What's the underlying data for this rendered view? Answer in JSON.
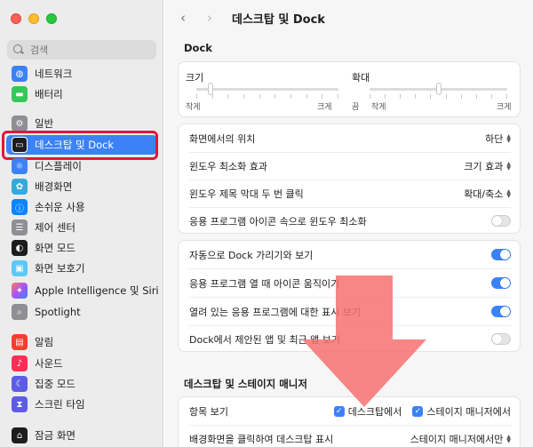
{
  "sidebar": {
    "search_placeholder": "검색",
    "items": [
      {
        "label": "네트워크",
        "icon": "network-icon",
        "color": "#3b82f6"
      },
      {
        "label": "배터리",
        "icon": "battery-icon",
        "color": "#34c759"
      },
      {
        "label": "일반",
        "icon": "gear-icon",
        "color": "#8e8e93"
      },
      {
        "label": "데스크탑 및 Dock",
        "icon": "dock-icon",
        "color": "#1d1d1f"
      },
      {
        "label": "디스플레이",
        "icon": "display-icon",
        "color": "#3b82f6"
      },
      {
        "label": "배경화면",
        "icon": "wallpaper-icon",
        "color": "#34aadc"
      },
      {
        "label": "손쉬운 사용",
        "icon": "accessibility-icon",
        "color": "#0a84ff"
      },
      {
        "label": "제어 센터",
        "icon": "control-center-icon",
        "color": "#8e8e93"
      },
      {
        "label": "화면 모드",
        "icon": "appearance-icon",
        "color": "#1d1d1f"
      },
      {
        "label": "화면 보호기",
        "icon": "screensaver-icon",
        "color": "#5ac8fa"
      },
      {
        "label": "Apple Intelligence 및 Siri",
        "icon": "siri-icon",
        "color": "#ff7a59"
      },
      {
        "label": "Spotlight",
        "icon": "spotlight-icon",
        "color": "#8e8e93"
      },
      {
        "label": "알림",
        "icon": "notifications-icon",
        "color": "#ff3b30"
      },
      {
        "label": "사운드",
        "icon": "sound-icon",
        "color": "#ff2d55"
      },
      {
        "label": "집중 모드",
        "icon": "focus-icon",
        "color": "#5e5ce6"
      },
      {
        "label": "스크린 타임",
        "icon": "screen-time-icon",
        "color": "#5e5ce6"
      },
      {
        "label": "잠금 화면",
        "icon": "lock-screen-icon",
        "color": "#1d1d1f"
      }
    ]
  },
  "toolbar": {
    "back": "‹",
    "forward": "›",
    "title": "데스크탑 및 Dock"
  },
  "dock": {
    "section_title": "Dock",
    "size_label": "크기",
    "size_min": "작게",
    "size_max": "크게",
    "size_value": 0.1,
    "magnify_label": "확대",
    "magnify_off": "끔",
    "magnify_min": "작게",
    "magnify_max": "크게",
    "magnify_value": 0.5,
    "position_label": "화면에서의 위치",
    "position_value": "하단",
    "minimize_label": "윈도우 최소화 효과",
    "minimize_value": "크기 효과",
    "titlebar_label": "윈도우 제목 막대 두 번 클릭",
    "titlebar_value": "확대/축소",
    "min_into_icon_label": "응용 프로그램 아이콘 속으로 윈도우 최소화",
    "min_into_icon_on": false,
    "autohide_label": "자동으로 Dock 가리기와 보기",
    "autohide_on": true,
    "animate_label": "응용 프로그램 열 때 아이콘 움직이기",
    "animate_on": true,
    "indicators_label": "열려 있는 응용 프로그램에 대한 표시 보기",
    "indicators_on": true,
    "recents_label": "Dock에서 제안된 앱 및 최근 앱 보기",
    "recents_on": false
  },
  "stage": {
    "section_title": "데스크탑 및 스테이지 매니저",
    "show_items_label": "항목 보기",
    "on_desktop": "데스크탑에서",
    "in_stage_manager": "스테이지 매니저에서",
    "click_wallpaper_label": "배경화면을 클릭하여 데스크탑 표시",
    "click_wallpaper_value": "스테이지 매니저에서만"
  },
  "colors": {
    "accent": "#3b82f6",
    "highlight": "#e0193a",
    "arrow": "#f87171"
  }
}
